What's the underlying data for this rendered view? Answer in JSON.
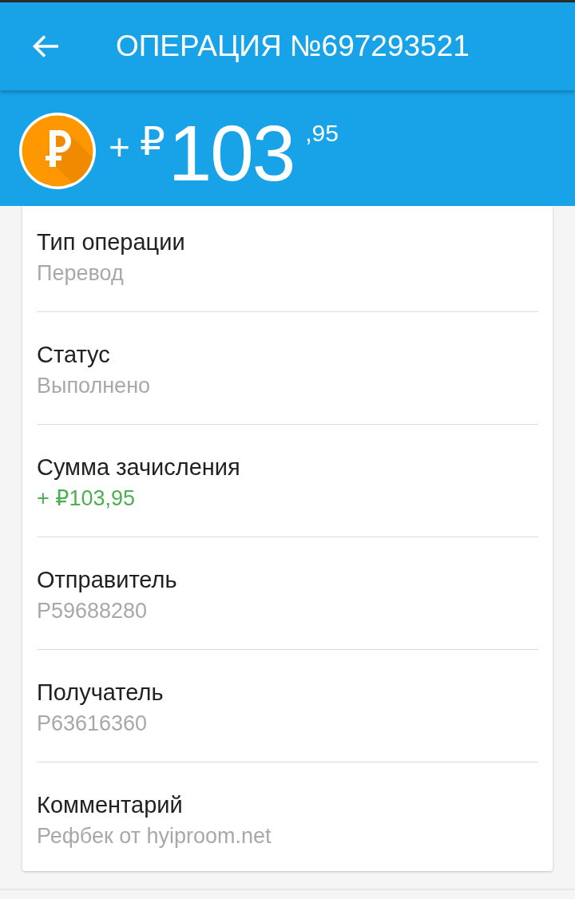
{
  "app_bar": {
    "title": "ОПЕРАЦИЯ №697293521"
  },
  "amount": {
    "sign": "+",
    "currency": "₽",
    "integer": "103",
    "fraction": ",95"
  },
  "details": [
    {
      "label": "Тип операции",
      "value": "Перевод",
      "kind": "plain"
    },
    {
      "label": "Статус",
      "value": "Выполнено",
      "kind": "plain"
    },
    {
      "label": "Сумма зачисления",
      "value": "+ ₽103,95",
      "kind": "credit"
    },
    {
      "label": "Отправитель",
      "value": "P59688280",
      "kind": "plain"
    },
    {
      "label": "Получатель",
      "value": "P63616360",
      "kind": "plain"
    },
    {
      "label": "Комментарий",
      "value": "Рефбек от hyiproom.net",
      "kind": "plain"
    }
  ]
}
